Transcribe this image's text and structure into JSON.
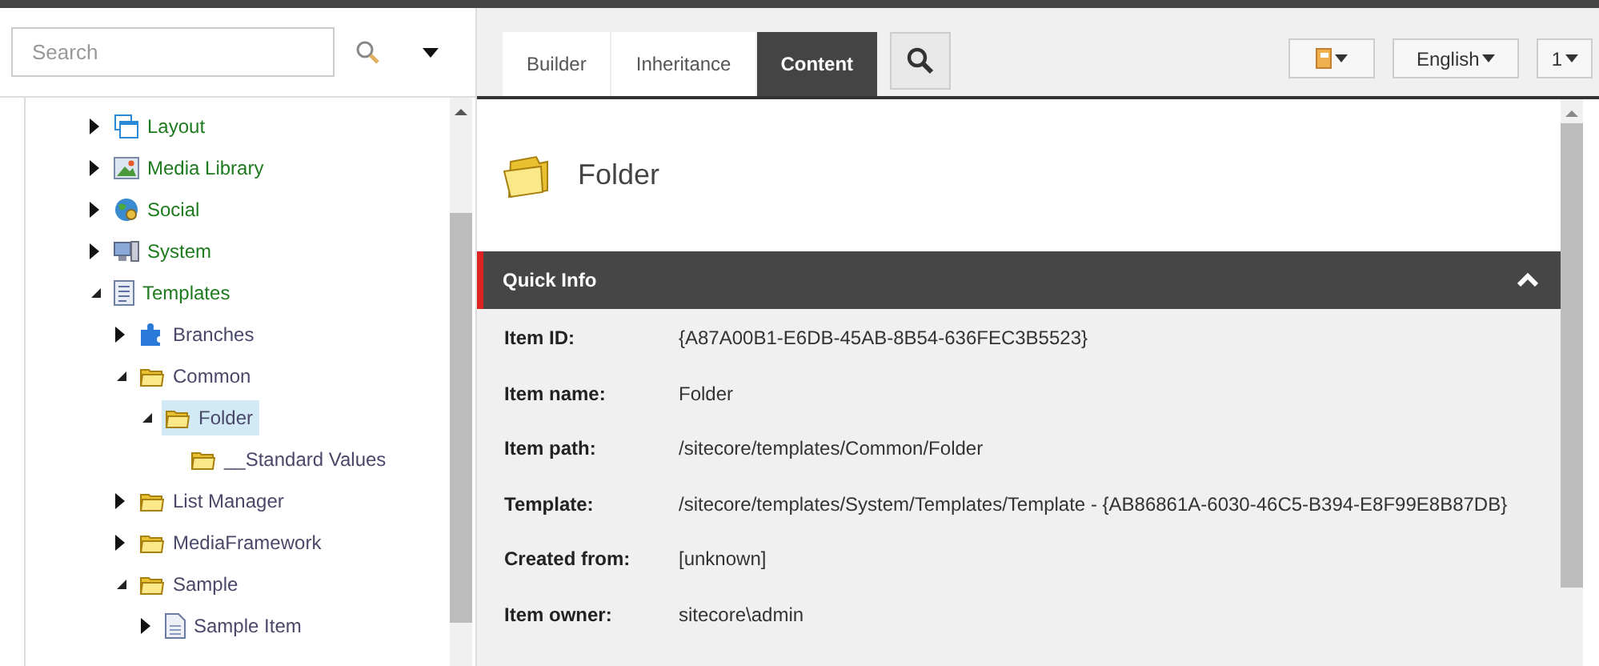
{
  "search": {
    "placeholder": "Search"
  },
  "tree": [
    {
      "label": "Layout",
      "kind": "layout",
      "expanded": false,
      "selected": false
    },
    {
      "label": "Media Library",
      "kind": "media",
      "expanded": false,
      "selected": false
    },
    {
      "label": "Social",
      "kind": "globe",
      "expanded": false,
      "selected": false
    },
    {
      "label": "System",
      "kind": "computer",
      "expanded": false,
      "selected": false
    },
    {
      "label": "Templates",
      "kind": "list",
      "expanded": true,
      "selected": false,
      "children": [
        {
          "label": "Branches",
          "kind": "puzzle",
          "expanded": false,
          "selected": false
        },
        {
          "label": "Common",
          "kind": "folder",
          "expanded": true,
          "selected": false,
          "children": [
            {
              "label": "Folder",
              "kind": "folder",
              "expanded": true,
              "selected": true,
              "children": [
                {
                  "label": "__Standard Values",
                  "kind": "folder",
                  "selected": false
                }
              ]
            }
          ]
        },
        {
          "label": "List Manager",
          "kind": "folder",
          "expanded": false,
          "selected": false
        },
        {
          "label": "MediaFramework",
          "kind": "folder",
          "expanded": false,
          "selected": false
        },
        {
          "label": "Sample",
          "kind": "folder",
          "expanded": true,
          "selected": false,
          "children": [
            {
              "label": "Sample Item",
              "kind": "page",
              "expanded": false,
              "selected": false
            }
          ]
        }
      ]
    }
  ],
  "tabs": [
    {
      "label": "Builder",
      "selected": false
    },
    {
      "label": "Inheritance",
      "selected": false
    },
    {
      "label": "Content",
      "selected": true
    }
  ],
  "language": "English",
  "version": "1",
  "item": {
    "title": "Folder"
  },
  "section": {
    "title": "Quick Info",
    "expanded": true
  },
  "fields": [
    {
      "label": "Item ID:",
      "value": "{A87A00B1-E6DB-45AB-8B54-636FEC3B5523}"
    },
    {
      "label": "Item name:",
      "value": "Folder"
    },
    {
      "label": "Item path:",
      "value": "/sitecore/templates/Common/Folder"
    },
    {
      "label": "Template:",
      "value": "/sitecore/templates/System/Templates/Template - {AB86861A-6030-46C5-B394-E8F99E8B87DB}"
    },
    {
      "label": "Created from:",
      "value": "[unknown]"
    },
    {
      "label": "Item owner:",
      "value": "sitecore\\admin"
    }
  ]
}
